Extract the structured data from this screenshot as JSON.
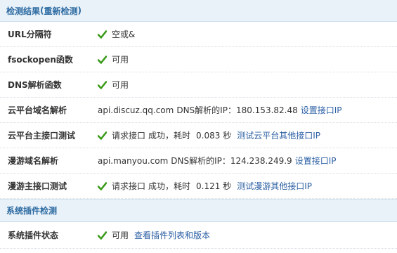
{
  "sections": {
    "check_results": {
      "title": "检测结果",
      "paren_open": "(",
      "recheck": "重新检测",
      "paren_close": ")"
    },
    "plugin_check": {
      "title": "系统插件检测"
    }
  },
  "rows": {
    "url_sep": {
      "label": "URL分隔符",
      "value": "空或&"
    },
    "fsockopen": {
      "label": "fsockopen函数",
      "value": "可用"
    },
    "dns_func": {
      "label": "DNS解析函数",
      "value": "可用"
    },
    "cloud_domain": {
      "label": "云平台域名解析",
      "host": "api.discuz.qq.com",
      "dns_label": "DNS解析的IP：",
      "ip": "180.153.82.48",
      "link": "设置接口IP"
    },
    "cloud_api": {
      "label": "云平台主接口测试",
      "req": "请求接口",
      "status": "成功，耗时",
      "time": "0.083 秒",
      "link": "测试云平台其他接口IP"
    },
    "manyou_domain": {
      "label": "漫游域名解析",
      "host": "api.manyou.com",
      "dns_label": "DNS解析的IP：",
      "ip": "124.238.249.9",
      "link": "设置接口IP"
    },
    "manyou_api": {
      "label": "漫游主接口测试",
      "req": "请求接口",
      "status": "成功，耗时",
      "time": "0.121 秒",
      "link": "测试漫游其他接口IP"
    },
    "plugin_status": {
      "label": "系统插件状态",
      "value": "可用",
      "link": "查看插件列表和版本"
    }
  },
  "colors": {
    "header_bg": "#e9f1f9",
    "header_text": "#2b6aa1",
    "link": "#2b5fa4",
    "check_green": "#3a9a1a"
  },
  "icons": {
    "status": "check-icon"
  }
}
